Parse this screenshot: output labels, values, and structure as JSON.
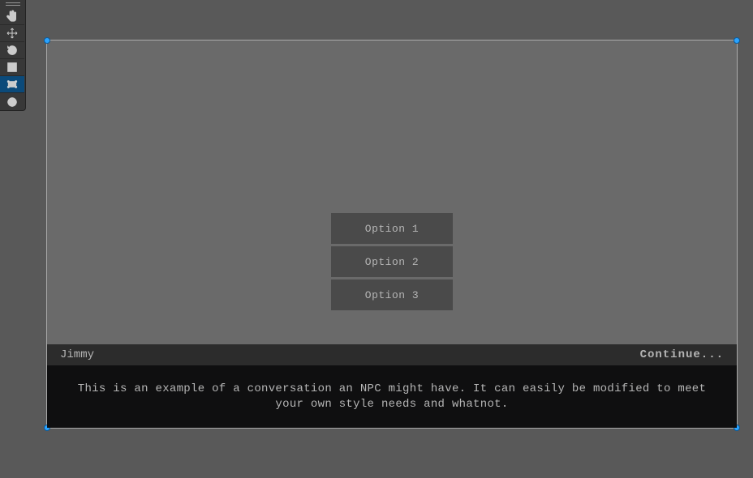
{
  "dialog": {
    "speaker": "Jimmy",
    "continue_label": "Continue...",
    "body": "This is an example of a conversation an NPC might have. It can easily be modified to meet your own style needs and whatnot."
  },
  "options": [
    {
      "label": "Option 1"
    },
    {
      "label": "Option 2"
    },
    {
      "label": "Option 3"
    }
  ],
  "tools": [
    {
      "name": "hand-icon"
    },
    {
      "name": "move-icon"
    },
    {
      "name": "rotate-icon"
    },
    {
      "name": "scale-icon"
    },
    {
      "name": "rect-icon"
    },
    {
      "name": "transform-icon"
    }
  ],
  "colors": {
    "accent": "#2aa3ff",
    "toolbar_active": "#0b4a7a"
  }
}
